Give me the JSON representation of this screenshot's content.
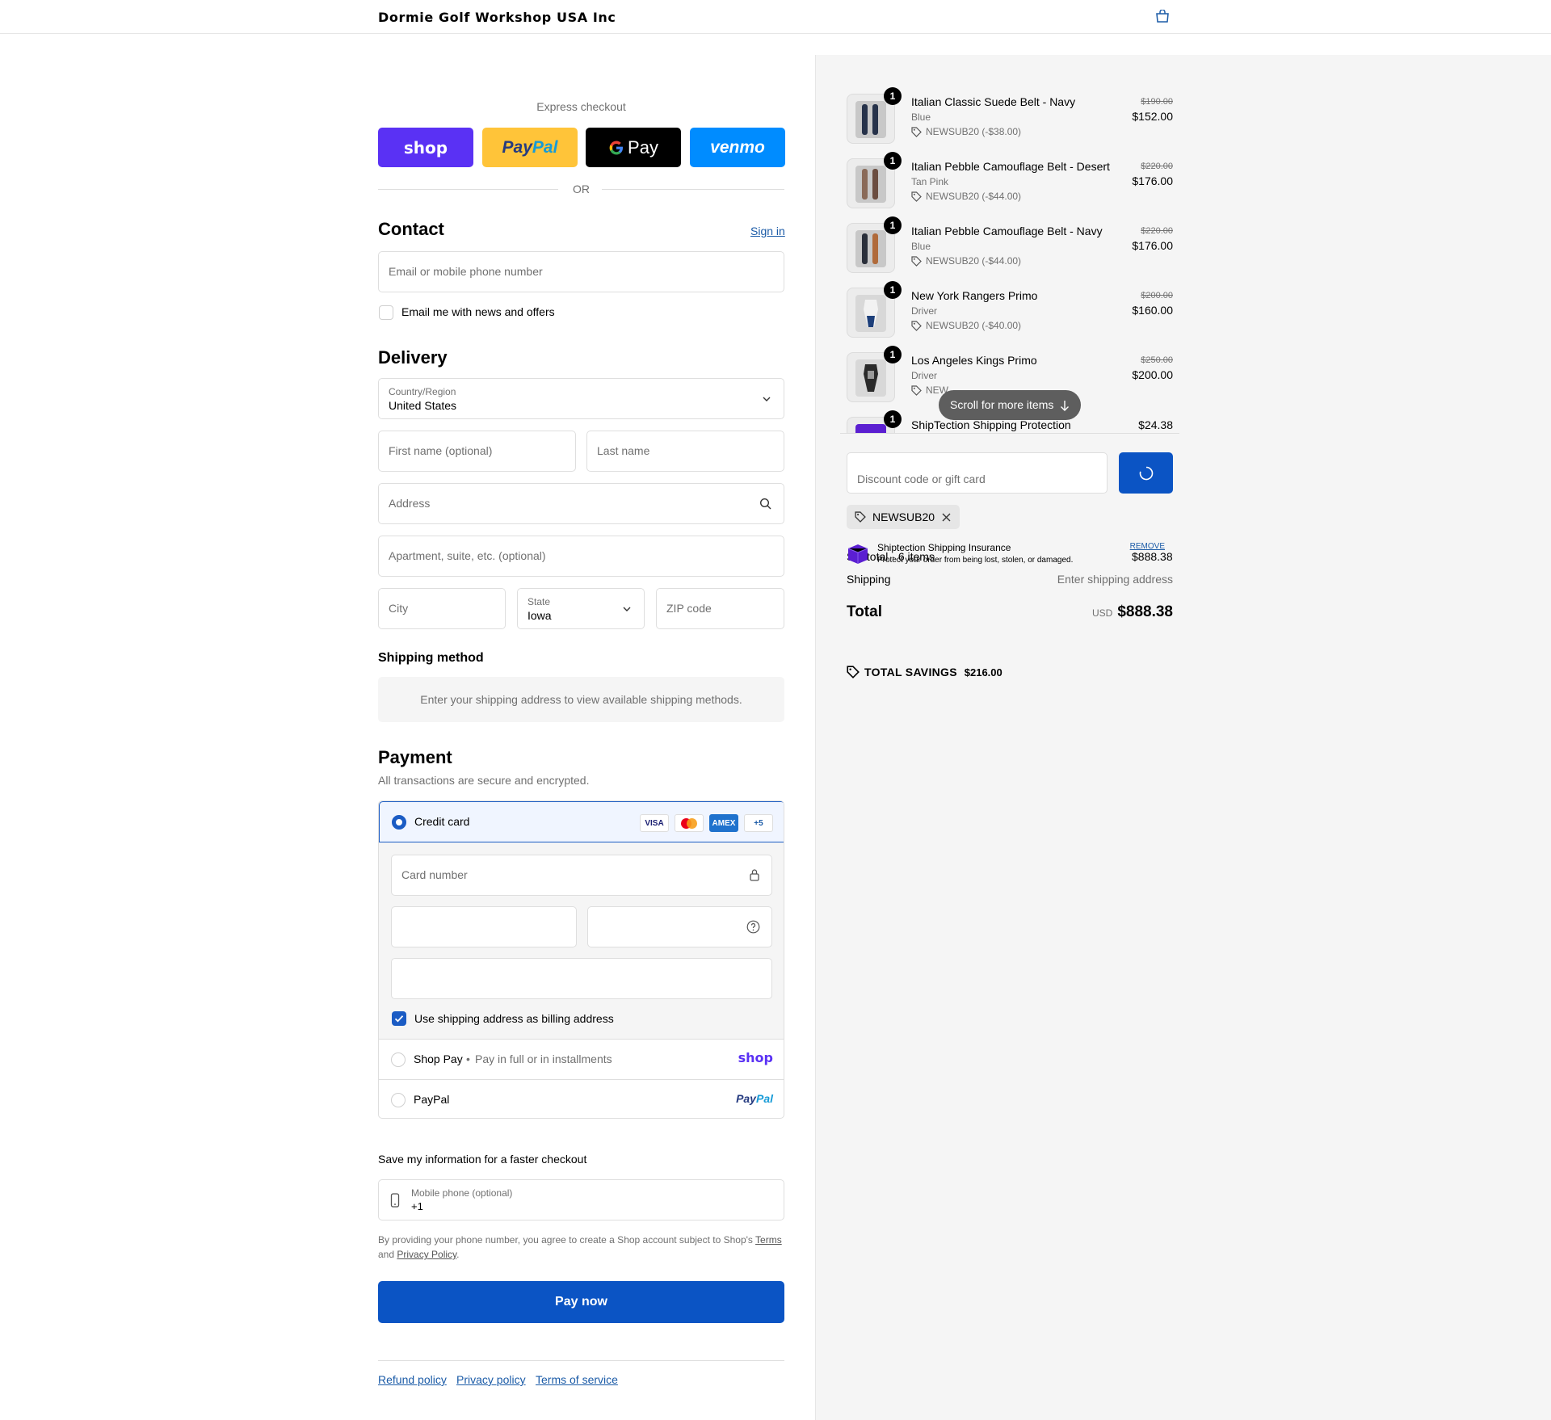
{
  "brand": "Dormie Golf Workshop USA Inc",
  "express": {
    "title": "Express checkout",
    "shop_label": "shop",
    "paypal_label_a": "Pay",
    "paypal_label_b": "Pal",
    "gpay_label": "Pay",
    "venmo_label": "venmo",
    "or_label": "OR"
  },
  "contact": {
    "heading": "Contact",
    "sign_in": "Sign in",
    "email_placeholder": "Email or mobile phone number",
    "news_label": "Email me with news and offers"
  },
  "delivery": {
    "heading": "Delivery",
    "country_label": "Country/Region",
    "country_value": "United States",
    "first_name_placeholder": "First name (optional)",
    "last_name_placeholder": "Last name",
    "address_placeholder": "Address",
    "apartment_placeholder": "Apartment, suite, etc. (optional)",
    "city_placeholder": "City",
    "state_label": "State",
    "state_value": "Iowa",
    "zip_placeholder": "ZIP code"
  },
  "shipping_method": {
    "heading": "Shipping method",
    "message": "Enter your shipping address to view available shipping methods."
  },
  "payment": {
    "heading": "Payment",
    "subtitle": "All transactions are secure and encrypted.",
    "credit_card_label": "Credit card",
    "more_cards": "+5",
    "visa": "VISA",
    "amex": "AMEX",
    "card_number_placeholder": "Card number",
    "billing_same_label": "Use shipping address as billing address",
    "shoppay_label": "Shop Pay",
    "shoppay_sub": "Pay in full or in installments",
    "shoppay_logo": "shop",
    "paypal_label": "PayPal",
    "paypal_logo_a": "Pay",
    "paypal_logo_b": "Pal"
  },
  "save_info": {
    "heading": "Save my information for a faster checkout",
    "phone_label": "Mobile phone (optional)",
    "phone_value": "+1",
    "legal_text": "By providing your phone number, you agree to create a Shop account subject to Shop's",
    "terms_link": "Terms",
    "and_text": "and",
    "privacy_link": "Privacy Policy"
  },
  "pay_now": "Pay now",
  "footer_links": [
    "Refund policy",
    "Privacy policy",
    "Terms of service"
  ],
  "cart": {
    "items": [
      {
        "name": "Italian Classic Suede Belt - Navy",
        "variant": "Blue",
        "discount": "NEWSUB20 (-$38.00)",
        "orig": "$190.00",
        "price": "$152.00",
        "qty": "1"
      },
      {
        "name": "Italian Pebble Camouflage Belt - Desert",
        "variant": "Tan Pink",
        "discount": "NEWSUB20 (-$44.00)",
        "orig": "$220.00",
        "price": "$176.00",
        "qty": "1"
      },
      {
        "name": "Italian Pebble Camouflage Belt - Navy",
        "variant": "Blue",
        "discount": "NEWSUB20 (-$44.00)",
        "orig": "$220.00",
        "price": "$176.00",
        "qty": "1"
      },
      {
        "name": "New York Rangers Primo",
        "variant": "Driver",
        "discount": "NEWSUB20 (-$40.00)",
        "orig": "$200.00",
        "price": "$160.00",
        "qty": "1"
      },
      {
        "name": "Los Angeles Kings Primo",
        "variant": "Driver",
        "discount": "NEW",
        "orig": "$250.00",
        "price": "$200.00",
        "qty": "1"
      },
      {
        "name": "ShipTection Shipping Protection",
        "variant": "",
        "discount": "",
        "orig": "",
        "price": "$24.38",
        "qty": "1"
      }
    ],
    "scroll_hint": "Scroll for more items",
    "discount_placeholder": "Discount code or gift card",
    "applied_code": "NEWSUB20",
    "insurance_title": "Shiptection Shipping Insurance",
    "insurance_sub": "Protect your order from being lost, stolen, or damaged.",
    "insurance_remove": "REMOVE",
    "subtotal_label": "Subtotal · 6 items",
    "subtotal_value": "$888.38",
    "shipping_label": "Shipping",
    "shipping_value": "Enter shipping address",
    "total_label": "Total",
    "currency": "USD",
    "total_value": "$888.38",
    "savings_label": "TOTAL SAVINGS",
    "savings_value": "$216.00"
  },
  "colors": {
    "accent": "#0b54c4",
    "shop_purple": "#5a31f4",
    "paypal_yellow": "#ffc439",
    "venmo_blue": "#008cff",
    "link": "#1b5ba7"
  }
}
